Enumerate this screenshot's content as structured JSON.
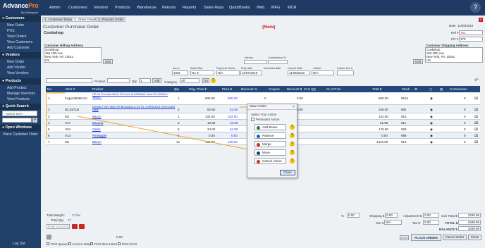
{
  "app": {
    "logo_main": "Advance",
    "logo_accent": "Pro",
    "logo_sub": "My Workspace"
  },
  "nav": [
    "Admin",
    "Customers",
    "Vendors",
    "Products",
    "Warehouse",
    "Returns",
    "Reports",
    "Sales Reps",
    "QuickBooks",
    "Web",
    "MFG",
    "MCR"
  ],
  "sidebar": {
    "customers_header": "Customers",
    "customers": [
      "New Order",
      "POS",
      "View Orders",
      "View Customers",
      "Add Customer"
    ],
    "vendors_header": "Vendors",
    "vendors": [
      "New Order",
      "Add Vendor",
      "View Vendors"
    ],
    "products_header": "Products",
    "products": [
      "Add Product",
      "Manage Inventory",
      "View Products"
    ],
    "quick_search_header": "Quick Search",
    "quick_select": "--Select Item--",
    "quick_go": "Go",
    "open_windows_header": "Open Windows",
    "open_windows": [
      "Place Customer Order"
    ],
    "logout": "Log Out"
  },
  "tabs": [
    "1. Customer Details",
    "2. Order Details",
    "3. Process Order"
  ],
  "order": {
    "title": "Customer Purchase Order",
    "status": "(New)",
    "customer": "Cookshop",
    "date_label": "Date",
    "date": "11/06/2019",
    "ref_label": "Ref #",
    "ref": "761",
    "po_label": "PO #",
    "po": "370",
    "billing_label": "Customer Billing Address",
    "billing": [
      "Cookshop",
      "156 10th Ave",
      "New York, NY, 10011",
      "US"
    ],
    "shipping_label": "Customer Shipping Address",
    "shipping": [
      "Cookshop",
      "156 10th Ave",
      "New York, NY, 10011",
      "US"
    ],
    "edit": "Edit",
    "vendor_label": "Vendor",
    "commission_label": "Commission %",
    "acct_label": "Acc #",
    "acct": "1001",
    "salesrep_label": "Sales Rep",
    "salesrep": "No S",
    "terms_label": "Payment Terms",
    "terms": "N/A",
    "ship_date_label": "Ship date",
    "ship_date": "11/07/2019",
    "expected_label": "Expected date",
    "expected": "11/05/2020",
    "cancel_label": "Cancel Date",
    "carrier_label": "Carrier",
    "carrier": "N/A",
    "carrier_acct_label": "Carrier Acc #"
  },
  "entry": {
    "sku_label": "SKU #",
    "product_label": "Product",
    "qty_label": "Qty",
    "qty": "1",
    "add": "Add",
    "category_label": "Category",
    "category": "All",
    "go": "Go"
  },
  "columns": [
    "No.",
    "SKU #",
    "Product",
    "Qty",
    "Orig. Price $",
    "Price $",
    "Discount %",
    "Coupon",
    "Discount $",
    "CLU Qty",
    "CLU Price",
    "Total $",
    "Stock",
    "Commission"
  ],
  "rows": [
    {
      "no": "1",
      "sku": "hxqp135368-01-",
      "product": "HP ML ProLiant ML10 G9 Core i3 4GB/Intel Xeon E3 1200v5 / 16GB...",
      "qty": "1",
      "orig": "500.00",
      "price": "500.00",
      "disc_pct": "0",
      "disc_amt": "0.00",
      "total": "500.00",
      "stock": "9515",
      "comm": "0"
    },
    {
      "no": "2",
      "sku": "DCS571B",
      "product": "DEWALT 20V MAX XR Brushless 6-1/2 IN. CORDLESS CIRCULAR SAW",
      "qty": "2",
      "orig": "52.50",
      "price": "52.50",
      "disc_pct": "0",
      "disc_amt": "0.00",
      "total": "105.00",
      "stock": "882",
      "comm": "0"
    },
    {
      "no": "3",
      "sku": "M1",
      "product": "Bacon",
      "qty": "1",
      "orig": "102.00",
      "price": "102.00",
      "disc_pct": "0",
      "disc_amt": "0.00",
      "total": "102.00",
      "stock": "915",
      "comm": "0"
    },
    {
      "no": "4",
      "sku": "V17",
      "product": "Banana",
      "qty": "3",
      "orig": "10.65",
      "price": "10.65",
      "disc_pct": "0",
      "disc_amt": "0.00",
      "total": "31.95",
      "stock": "911",
      "comm": "0"
    },
    {
      "no": "5",
      "sku": "V04",
      "product": "Garlic",
      "qty": "5",
      "orig": "34.00",
      "price": "34.00",
      "disc_pct": "0",
      "disc_amt": "0.00",
      "total": "170.00",
      "stock": "929",
      "comm": "0"
    },
    {
      "no": "6",
      "sku": "V13",
      "product": "Pineapple",
      "qty": "3",
      "orig": "0.00",
      "price": "0.00",
      "disc_pct": "0",
      "disc_amt": "0.00",
      "total": "0.00",
      "stock": "988",
      "comm": "0"
    },
    {
      "no": "7",
      "sku": "M1",
      "product": "Bacon",
      "qty": "12",
      "orig": "102.00",
      "price": "120.00",
      "disc_pct": "0",
      "disc_amt": "0.00",
      "total": "1440.00",
      "stock": "915",
      "comm": "0"
    }
  ],
  "dialog": {
    "title": "New Action",
    "section": "Select Your Action",
    "persistent": "Persistent Action",
    "actions": [
      "Add Below",
      "Replace",
      "Merge",
      "Move",
      "Cancel Action"
    ],
    "close": "Close"
  },
  "footer": {
    "total_weight_label": "Total Weight:",
    "total_weight": "27 lbs",
    "total_qty_label": "Total Qty:",
    "total_qty": "27",
    "discount_placeholder": "Enter Discount",
    "pct_label": "%",
    "pct": "0.00",
    "shipping_label": "Shipping $",
    "shipping": "0.00",
    "adjustment_label": "Adjustment $",
    "adjustment": "0.00",
    "subtotal_label": "Sub Total $",
    "subtotal": "2348.95",
    "tax_label": "Tax %",
    "tax": "N/A",
    "tax_amt_label": "Tax $",
    "tax_amt": "0.00",
    "total_label": "TOTAL $",
    "total": "2348.95",
    "balance_label": "BALANCE $",
    "balance": "2348.95",
    "amount": "0.00",
    "print_queue": "Print Queue",
    "invoice_only": "Invoice Only",
    "print_item_notes": "Print Item Notes",
    "print_pan": "Print P/AN",
    "save": "Save",
    "place_order": "PLACE ORDER",
    "cancel_order": "Cancel Order",
    "close": "Close"
  },
  "colors": {
    "header": "#1f3b63",
    "accent": "#ff7a1a",
    "grid_header": "#25467a",
    "status": "#d02020"
  }
}
